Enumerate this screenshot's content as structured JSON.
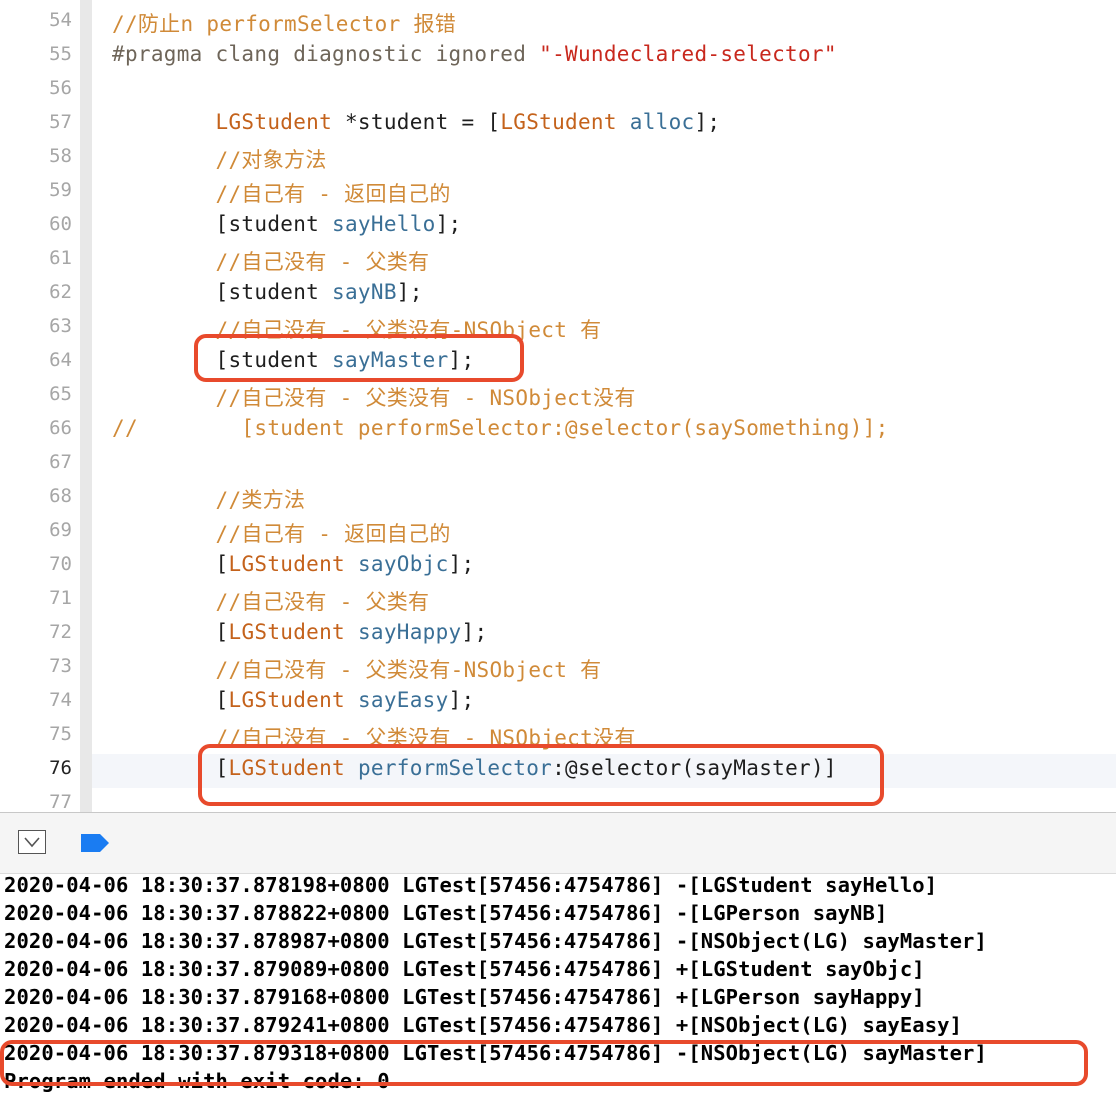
{
  "editor": {
    "current_line": "76",
    "lines": [
      {
        "num": "54",
        "tokens": [
          {
            "t": "//防止n performSelector 报错",
            "c": "c-cm"
          }
        ]
      },
      {
        "num": "55",
        "tokens": [
          {
            "t": "#pragma clang diagnostic ignored ",
            "c": "c-pp"
          },
          {
            "t": "\"-Wundeclared-selector\"",
            "c": "c-st"
          }
        ]
      },
      {
        "num": "56",
        "tokens": []
      },
      {
        "num": "57",
        "tokens": [
          {
            "t": "        LGStudent",
            "c": "c-kw"
          },
          {
            "t": " *student = [",
            "c": "c-pl"
          },
          {
            "t": "LGStudent",
            "c": "c-kw"
          },
          {
            "t": " ",
            "c": "c-pl"
          },
          {
            "t": "alloc",
            "c": "c-mt"
          },
          {
            "t": "];",
            "c": "c-pl"
          }
        ]
      },
      {
        "num": "58",
        "tokens": [
          {
            "t": "        //对象方法",
            "c": "c-cm"
          }
        ]
      },
      {
        "num": "59",
        "tokens": [
          {
            "t": "        //自己有 - 返回自己的",
            "c": "c-cm"
          }
        ]
      },
      {
        "num": "60",
        "tokens": [
          {
            "t": "        [student ",
            "c": "c-pl"
          },
          {
            "t": "sayHello",
            "c": "c-mt"
          },
          {
            "t": "];",
            "c": "c-pl"
          }
        ]
      },
      {
        "num": "61",
        "tokens": [
          {
            "t": "        //自己没有 - 父类有",
            "c": "c-cm"
          }
        ]
      },
      {
        "num": "62",
        "tokens": [
          {
            "t": "        [student ",
            "c": "c-pl"
          },
          {
            "t": "sayNB",
            "c": "c-mt"
          },
          {
            "t": "];",
            "c": "c-pl"
          }
        ]
      },
      {
        "num": "63",
        "tokens": [
          {
            "t": "        //自己没有 - 父类没有-NSObject 有",
            "c": "c-cm"
          }
        ]
      },
      {
        "num": "64",
        "tokens": [
          {
            "t": "        [student ",
            "c": "c-pl"
          },
          {
            "t": "sayMaster",
            "c": "c-mt"
          },
          {
            "t": "];",
            "c": "c-pl"
          }
        ]
      },
      {
        "num": "65",
        "tokens": [
          {
            "t": "        //自己没有 - 父类没有 - NSObject没有",
            "c": "c-cm"
          }
        ]
      },
      {
        "num": "66",
        "tokens": [
          {
            "t": "//        [student performSelector:@selector(saySomething)];",
            "c": "c-cm"
          }
        ]
      },
      {
        "num": "67",
        "tokens": []
      },
      {
        "num": "68",
        "tokens": [
          {
            "t": "        //类方法",
            "c": "c-cm"
          }
        ]
      },
      {
        "num": "69",
        "tokens": [
          {
            "t": "        //自己有 - 返回自己的",
            "c": "c-cm"
          }
        ]
      },
      {
        "num": "70",
        "tokens": [
          {
            "t": "        [",
            "c": "c-pl"
          },
          {
            "t": "LGStudent",
            "c": "c-kw"
          },
          {
            "t": " ",
            "c": "c-pl"
          },
          {
            "t": "sayObjc",
            "c": "c-mt"
          },
          {
            "t": "];",
            "c": "c-pl"
          }
        ]
      },
      {
        "num": "71",
        "tokens": [
          {
            "t": "        //自己没有 - 父类有",
            "c": "c-cm"
          }
        ]
      },
      {
        "num": "72",
        "tokens": [
          {
            "t": "        [",
            "c": "c-pl"
          },
          {
            "t": "LGStudent",
            "c": "c-kw"
          },
          {
            "t": " ",
            "c": "c-pl"
          },
          {
            "t": "sayHappy",
            "c": "c-mt"
          },
          {
            "t": "];",
            "c": "c-pl"
          }
        ]
      },
      {
        "num": "73",
        "tokens": [
          {
            "t": "        //自己没有 - 父类没有-NSObject 有",
            "c": "c-cm"
          }
        ]
      },
      {
        "num": "74",
        "tokens": [
          {
            "t": "        [",
            "c": "c-pl"
          },
          {
            "t": "LGStudent",
            "c": "c-kw"
          },
          {
            "t": " ",
            "c": "c-pl"
          },
          {
            "t": "sayEasy",
            "c": "c-mt"
          },
          {
            "t": "];",
            "c": "c-pl"
          }
        ]
      },
      {
        "num": "75",
        "tokens": [
          {
            "t": "        //自己没有 - 父类没有 - NSObject没有",
            "c": "c-cm"
          }
        ]
      },
      {
        "num": "76",
        "tokens": [
          {
            "t": "        [",
            "c": "c-pl"
          },
          {
            "t": "LGStudent",
            "c": "c-kw"
          },
          {
            "t": " ",
            "c": "c-pl"
          },
          {
            "t": "performSelector",
            "c": "c-mt"
          },
          {
            "t": ":@selector(sayMaster)]",
            "c": "c-pl"
          }
        ]
      },
      {
        "num": "77",
        "tokens": []
      }
    ]
  },
  "console": {
    "lines": [
      "2020-04-06 18:30:37.878198+0800 LGTest[57456:4754786] -[LGStudent sayHello]",
      "2020-04-06 18:30:37.878822+0800 LGTest[57456:4754786] -[LGPerson sayNB]",
      "2020-04-06 18:30:37.878987+0800 LGTest[57456:4754786] -[NSObject(LG) sayMaster]",
      "2020-04-06 18:30:37.879089+0800 LGTest[57456:4754786] +[LGStudent sayObjc]",
      "2020-04-06 18:30:37.879168+0800 LGTest[57456:4754786] +[LGPerson sayHappy]",
      "2020-04-06 18:30:37.879241+0800 LGTest[57456:4754786] +[NSObject(LG) sayEasy]",
      "2020-04-06 18:30:37.879318+0800 LGTest[57456:4754786] -[NSObject(LG) sayMaster]",
      "Program ended with exit code: 0"
    ]
  },
  "debug_bar": {
    "hide_icon": "hide-debug-area-icon",
    "breakpoint_icon": "breakpoint-icon"
  },
  "colors": {
    "highlight_box": "#e84a2c",
    "keyword": "#c4621b",
    "comment": "#d08a38",
    "method": "#3a6f96",
    "string": "#c8281d"
  }
}
